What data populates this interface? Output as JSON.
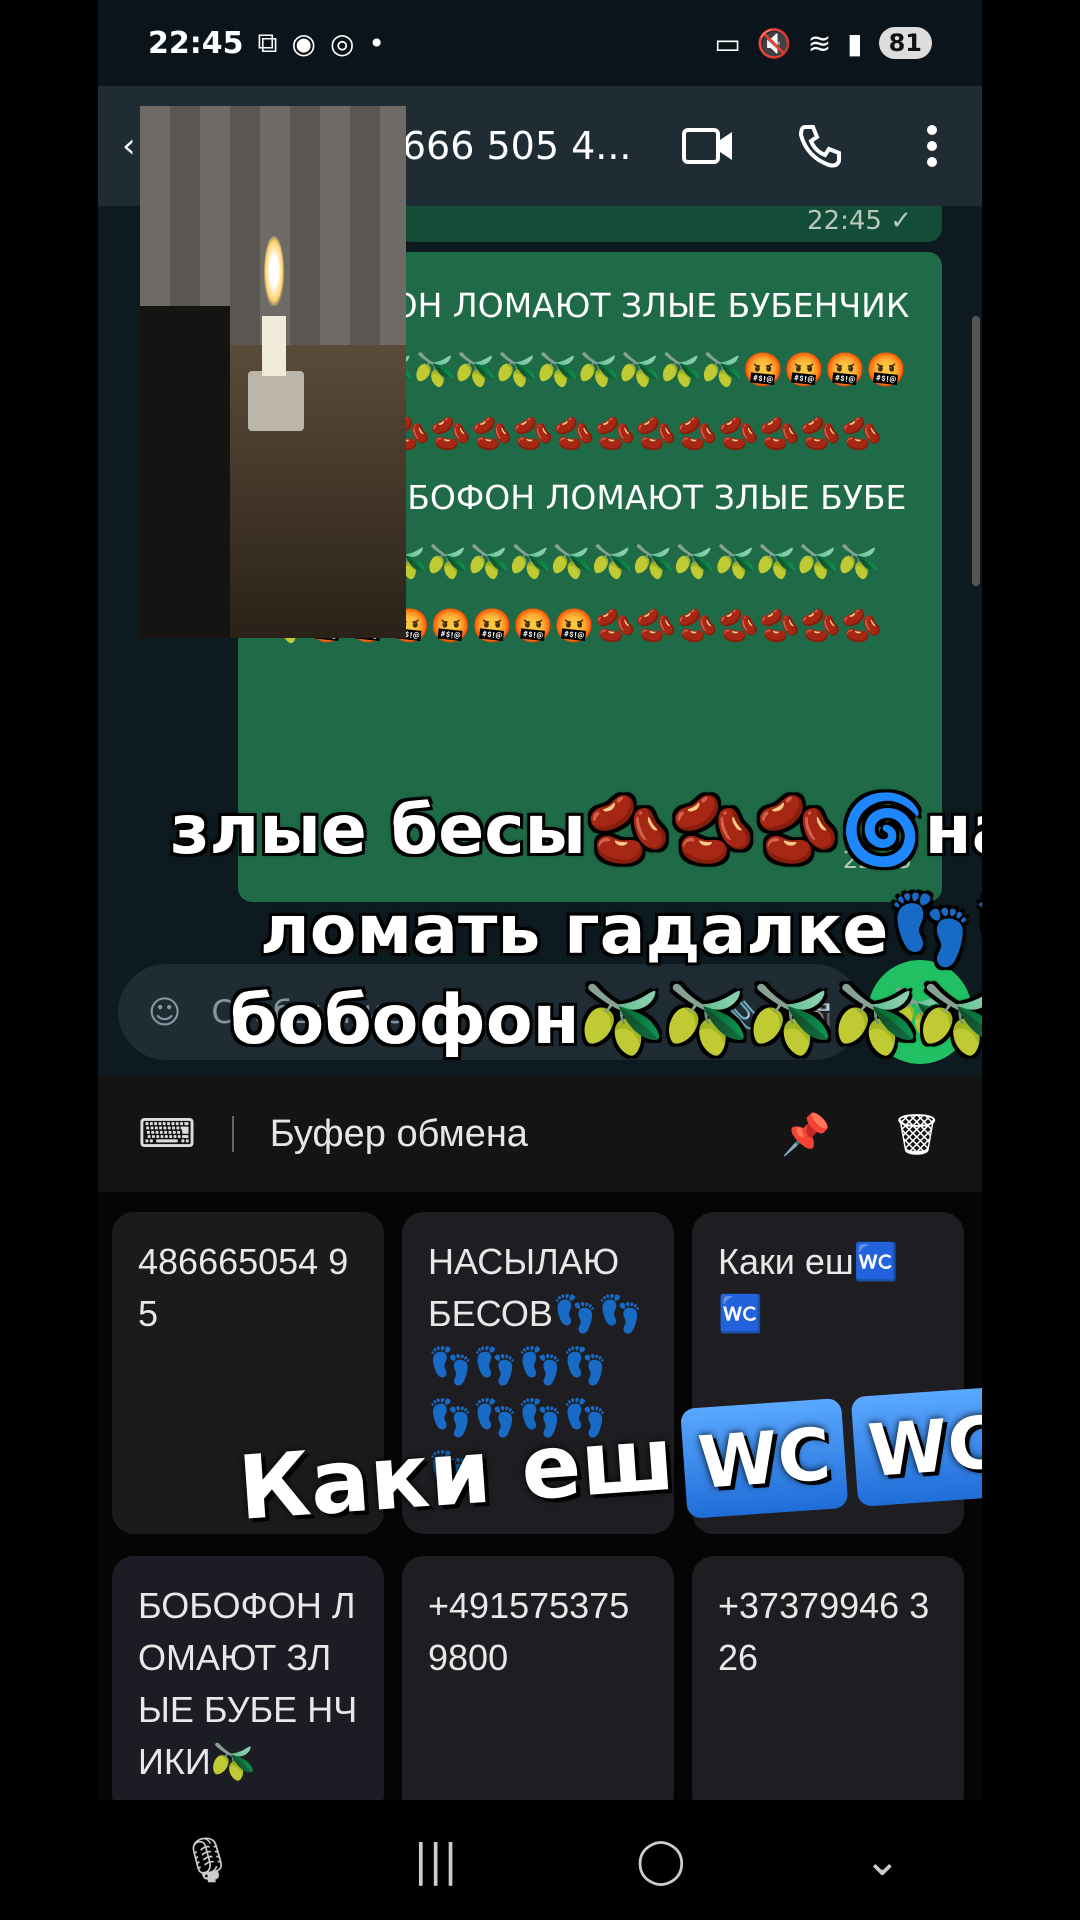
{
  "status": {
    "time": "22:45",
    "left_icons": [
      "screenshot-icon",
      "messenger-app-icon",
      "messenger-icon",
      "dot-icon"
    ],
    "battery": "81"
  },
  "header": {
    "title": "8 666 505 4..."
  },
  "chat": {
    "prev_time": "22:45 ✓",
    "message": "БОБОФОН ЛОМАЮТ ЗЛЫЕ БУБЕНЧИКИ🫒🫒🫒🫒🫒🫒🫒🫒🫒🫒🫒🤬🤬🤬🤬🤬🫘🫘🫘🫘🫘🫘🫘🫘🫘🫘🫘🫘🫘🫘🫘🫘 БОБОФОН ЛОМАЮТ ЗЛЫЕ БУБЕНЧИКИ🫒🫒🫒🫒🫒🫒🫒🫒🫒🫒🫒🫒🫒🤬🤬🤬🤬🤬🤬🤬🫘🫘🫘🫘🫘🫘🫘",
    "msg_time": "22:45",
    "input_placeholder": "Сообщение"
  },
  "captions": {
    "line1": "злые бесы🫘🫘🫘🌀начали",
    "line2": "ломать гадалке👣👣👣",
    "line3": "бобофон🫒🫒🫒🫒🫒"
  },
  "clipboard": {
    "title": "Буфер обмена",
    "items": [
      "486665054 95",
      "НАСЫЛАЮ БЕСОВ👣👣👣👣👣👣👣👣👣👣👣",
      "Каки еш🚾🚾",
      "БОБОФОН ЛОМАЮТ ЗЛЫЕ БУБЕ НЧИКИ🫒",
      "+491575375 9800",
      "+37379946 326"
    ]
  },
  "big_caption": {
    "text": "Каки еш",
    "wc1": "WC",
    "wc2": "WC"
  },
  "colors": {
    "bubble": "#1f6b48",
    "header": "#1f2c34",
    "accent_green": "#21c063"
  }
}
